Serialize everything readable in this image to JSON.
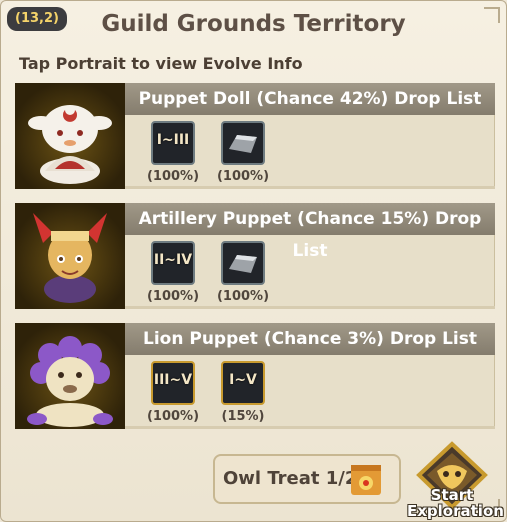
{
  "header": {
    "coords": "(13,2)",
    "title": "Guild Grounds Territory"
  },
  "subtitle": "Tap Portrait to view Evolve Info",
  "cards": [
    {
      "title": "Puppet Doll (Chance 42%)  Drop List",
      "items": [
        {
          "label": "I~III",
          "pct": "(100%)",
          "icon": "evolve-scroll-icon"
        },
        {
          "label": "",
          "pct": "(100%)",
          "icon": "silver-ingot-icon"
        }
      ]
    },
    {
      "title": "Artillery Puppet (Chance 15%)  Drop List",
      "items": [
        {
          "label": "II~IV",
          "pct": "(100%)",
          "icon": "evolve-scroll-icon"
        },
        {
          "label": "",
          "pct": "(100%)",
          "icon": "silver-ingot-icon"
        }
      ]
    },
    {
      "title": "Lion Puppet (Chance 3%)  Drop List",
      "items": [
        {
          "label": "III~V",
          "pct": "(100%)",
          "icon": "evolve-scroll-icon"
        },
        {
          "label": "I~V",
          "pct": "(15%)",
          "icon": "evolve-scroll-gold-icon"
        }
      ]
    }
  ],
  "footer": {
    "treat_label": "Owl Treat 1/25",
    "start_label_line1": "Start",
    "start_label_line2": "Exploration"
  },
  "colors": {
    "header_bar": "#938b7c",
    "panel_bg": "#efe7d6",
    "title_text": "#5e5046",
    "coords_text": "#f5d46a",
    "gold_accent": "#c89a2e"
  }
}
